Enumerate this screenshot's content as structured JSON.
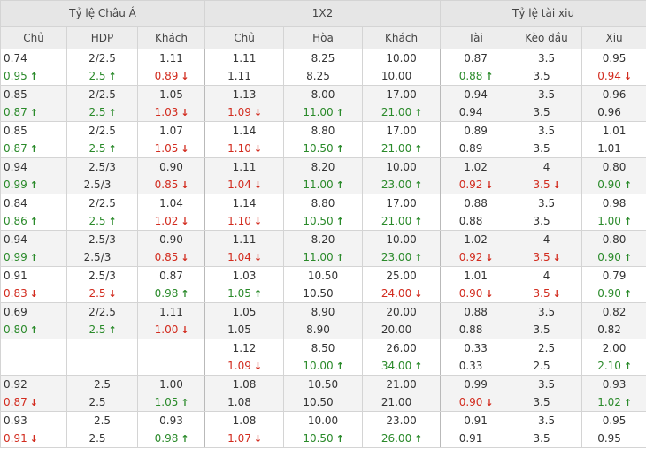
{
  "groups": [
    "Tỷ lệ Châu Á",
    "1X2",
    "Tỷ lệ tài xiu"
  ],
  "columns": [
    "Chủ",
    "HDP",
    "Khách",
    "Chủ",
    "Hòa",
    "Khách",
    "Tài",
    "Kèo đầu",
    "Xiu"
  ],
  "colors": {
    "up": "#2a8a2a",
    "down": "#d22b1e",
    "header_bg": "#e6e6e6",
    "alt_row_bg": "#f3f3f3"
  },
  "rows": [
    [
      [
        {
          "v": "0.74"
        },
        {
          "v": "0.95",
          "t": "up"
        }
      ],
      [
        {
          "v": "2/2.5"
        },
        {
          "v": "2.5",
          "t": "up"
        }
      ],
      [
        {
          "v": "1.11"
        },
        {
          "v": "0.89",
          "t": "down"
        }
      ],
      [
        {
          "v": "1.11"
        },
        {
          "v": "1.11"
        }
      ],
      [
        {
          "v": "8.25"
        },
        {
          "v": "8.25"
        }
      ],
      [
        {
          "v": "10.00"
        },
        {
          "v": "10.00"
        }
      ],
      [
        {
          "v": "0.87"
        },
        {
          "v": "0.88",
          "t": "up"
        }
      ],
      [
        {
          "v": "3.5"
        },
        {
          "v": "3.5"
        }
      ],
      [
        {
          "v": "0.95"
        },
        {
          "v": "0.94",
          "t": "down"
        }
      ]
    ],
    [
      [
        {
          "v": "0.85"
        },
        {
          "v": "0.87",
          "t": "up"
        }
      ],
      [
        {
          "v": "2/2.5"
        },
        {
          "v": "2.5",
          "t": "up"
        }
      ],
      [
        {
          "v": "1.05"
        },
        {
          "v": "1.03",
          "t": "down"
        }
      ],
      [
        {
          "v": "1.13"
        },
        {
          "v": "1.09",
          "t": "down"
        }
      ],
      [
        {
          "v": "8.00"
        },
        {
          "v": "11.00",
          "t": "up"
        }
      ],
      [
        {
          "v": "17.00"
        },
        {
          "v": "21.00",
          "t": "up"
        }
      ],
      [
        {
          "v": "0.94"
        },
        {
          "v": "0.94"
        }
      ],
      [
        {
          "v": "3.5"
        },
        {
          "v": "3.5"
        }
      ],
      [
        {
          "v": "0.96"
        },
        {
          "v": "0.96"
        }
      ]
    ],
    [
      [
        {
          "v": "0.85"
        },
        {
          "v": "0.87",
          "t": "up"
        }
      ],
      [
        {
          "v": "2/2.5"
        },
        {
          "v": "2.5",
          "t": "up"
        }
      ],
      [
        {
          "v": "1.07"
        },
        {
          "v": "1.05",
          "t": "down"
        }
      ],
      [
        {
          "v": "1.14"
        },
        {
          "v": "1.10",
          "t": "down"
        }
      ],
      [
        {
          "v": "8.80"
        },
        {
          "v": "10.50",
          "t": "up"
        }
      ],
      [
        {
          "v": "17.00"
        },
        {
          "v": "21.00",
          "t": "up"
        }
      ],
      [
        {
          "v": "0.89"
        },
        {
          "v": "0.89"
        }
      ],
      [
        {
          "v": "3.5"
        },
        {
          "v": "3.5"
        }
      ],
      [
        {
          "v": "1.01"
        },
        {
          "v": "1.01"
        }
      ]
    ],
    [
      [
        {
          "v": "0.94"
        },
        {
          "v": "0.99",
          "t": "up"
        }
      ],
      [
        {
          "v": "2.5/3"
        },
        {
          "v": "2.5/3"
        }
      ],
      [
        {
          "v": "0.90"
        },
        {
          "v": "0.85",
          "t": "down"
        }
      ],
      [
        {
          "v": "1.11"
        },
        {
          "v": "1.04",
          "t": "down"
        }
      ],
      [
        {
          "v": "8.20"
        },
        {
          "v": "11.00",
          "t": "up"
        }
      ],
      [
        {
          "v": "10.00"
        },
        {
          "v": "23.00",
          "t": "up"
        }
      ],
      [
        {
          "v": "1.02"
        },
        {
          "v": "0.92",
          "t": "down"
        }
      ],
      [
        {
          "v": "4"
        },
        {
          "v": "3.5",
          "t": "down"
        }
      ],
      [
        {
          "v": "0.80"
        },
        {
          "v": "0.90",
          "t": "up"
        }
      ]
    ],
    [
      [
        {
          "v": "0.84"
        },
        {
          "v": "0.86",
          "t": "up"
        }
      ],
      [
        {
          "v": "2/2.5"
        },
        {
          "v": "2.5",
          "t": "up"
        }
      ],
      [
        {
          "v": "1.04"
        },
        {
          "v": "1.02",
          "t": "down"
        }
      ],
      [
        {
          "v": "1.14"
        },
        {
          "v": "1.10",
          "t": "down"
        }
      ],
      [
        {
          "v": "8.80"
        },
        {
          "v": "10.50",
          "t": "up"
        }
      ],
      [
        {
          "v": "17.00"
        },
        {
          "v": "21.00",
          "t": "up"
        }
      ],
      [
        {
          "v": "0.88"
        },
        {
          "v": "0.88"
        }
      ],
      [
        {
          "v": "3.5"
        },
        {
          "v": "3.5"
        }
      ],
      [
        {
          "v": "0.98"
        },
        {
          "v": "1.00",
          "t": "up"
        }
      ]
    ],
    [
      [
        {
          "v": "0.94"
        },
        {
          "v": "0.99",
          "t": "up"
        }
      ],
      [
        {
          "v": "2.5/3"
        },
        {
          "v": "2.5/3"
        }
      ],
      [
        {
          "v": "0.90"
        },
        {
          "v": "0.85",
          "t": "down"
        }
      ],
      [
        {
          "v": "1.11"
        },
        {
          "v": "1.04",
          "t": "down"
        }
      ],
      [
        {
          "v": "8.20"
        },
        {
          "v": "11.00",
          "t": "up"
        }
      ],
      [
        {
          "v": "10.00"
        },
        {
          "v": "23.00",
          "t": "up"
        }
      ],
      [
        {
          "v": "1.02"
        },
        {
          "v": "0.92",
          "t": "down"
        }
      ],
      [
        {
          "v": "4"
        },
        {
          "v": "3.5",
          "t": "down"
        }
      ],
      [
        {
          "v": "0.80"
        },
        {
          "v": "0.90",
          "t": "up"
        }
      ]
    ],
    [
      [
        {
          "v": "0.91"
        },
        {
          "v": "0.83",
          "t": "down"
        }
      ],
      [
        {
          "v": "2.5/3"
        },
        {
          "v": "2.5",
          "t": "down"
        }
      ],
      [
        {
          "v": "0.87"
        },
        {
          "v": "0.98",
          "t": "up"
        }
      ],
      [
        {
          "v": "1.03"
        },
        {
          "v": "1.05",
          "t": "up"
        }
      ],
      [
        {
          "v": "10.50"
        },
        {
          "v": "10.50"
        }
      ],
      [
        {
          "v": "25.00"
        },
        {
          "v": "24.00",
          "t": "down"
        }
      ],
      [
        {
          "v": "1.01"
        },
        {
          "v": "0.90",
          "t": "down"
        }
      ],
      [
        {
          "v": "4"
        },
        {
          "v": "3.5",
          "t": "down"
        }
      ],
      [
        {
          "v": "0.79"
        },
        {
          "v": "0.90",
          "t": "up"
        }
      ]
    ],
    [
      [
        {
          "v": "0.69"
        },
        {
          "v": "0.80",
          "t": "up"
        }
      ],
      [
        {
          "v": "2/2.5"
        },
        {
          "v": "2.5",
          "t": "up"
        }
      ],
      [
        {
          "v": "1.11"
        },
        {
          "v": "1.00",
          "t": "down"
        }
      ],
      [
        {
          "v": "1.05"
        },
        {
          "v": "1.05"
        }
      ],
      [
        {
          "v": "8.90"
        },
        {
          "v": "8.90"
        }
      ],
      [
        {
          "v": "20.00"
        },
        {
          "v": "20.00"
        }
      ],
      [
        {
          "v": "0.88"
        },
        {
          "v": "0.88"
        }
      ],
      [
        {
          "v": "3.5"
        },
        {
          "v": "3.5"
        }
      ],
      [
        {
          "v": "0.82"
        },
        {
          "v": "0.82"
        }
      ]
    ],
    [
      [],
      [],
      [],
      [
        {
          "v": "1.12"
        },
        {
          "v": "1.09",
          "t": "down"
        }
      ],
      [
        {
          "v": "8.50"
        },
        {
          "v": "10.00",
          "t": "up"
        }
      ],
      [
        {
          "v": "26.00"
        },
        {
          "v": "34.00",
          "t": "up"
        }
      ],
      [
        {
          "v": "0.33"
        },
        {
          "v": "0.33"
        }
      ],
      [
        {
          "v": "2.5"
        },
        {
          "v": "2.5"
        }
      ],
      [
        {
          "v": "2.00"
        },
        {
          "v": "2.10",
          "t": "up"
        }
      ]
    ],
    [
      [
        {
          "v": "0.92"
        },
        {
          "v": "0.87",
          "t": "down"
        }
      ],
      [
        {
          "v": "2.5"
        },
        {
          "v": "2.5"
        }
      ],
      [
        {
          "v": "1.00"
        },
        {
          "v": "1.05",
          "t": "up"
        }
      ],
      [
        {
          "v": "1.08"
        },
        {
          "v": "1.08"
        }
      ],
      [
        {
          "v": "10.50"
        },
        {
          "v": "10.50"
        }
      ],
      [
        {
          "v": "21.00"
        },
        {
          "v": "21.00"
        }
      ],
      [
        {
          "v": "0.99"
        },
        {
          "v": "0.90",
          "t": "down"
        }
      ],
      [
        {
          "v": "3.5"
        },
        {
          "v": "3.5"
        }
      ],
      [
        {
          "v": "0.93"
        },
        {
          "v": "1.02",
          "t": "up"
        }
      ]
    ],
    [
      [
        {
          "v": "0.93"
        },
        {
          "v": "0.91",
          "t": "down"
        }
      ],
      [
        {
          "v": "2.5"
        },
        {
          "v": "2.5"
        }
      ],
      [
        {
          "v": "0.93"
        },
        {
          "v": "0.98",
          "t": "up"
        }
      ],
      [
        {
          "v": "1.08"
        },
        {
          "v": "1.07",
          "t": "down"
        }
      ],
      [
        {
          "v": "10.00"
        },
        {
          "v": "10.50",
          "t": "up"
        }
      ],
      [
        {
          "v": "23.00"
        },
        {
          "v": "26.00",
          "t": "up"
        }
      ],
      [
        {
          "v": "0.91"
        },
        {
          "v": "0.91"
        }
      ],
      [
        {
          "v": "3.5"
        },
        {
          "v": "3.5"
        }
      ],
      [
        {
          "v": "0.95"
        },
        {
          "v": "0.95"
        }
      ]
    ]
  ]
}
